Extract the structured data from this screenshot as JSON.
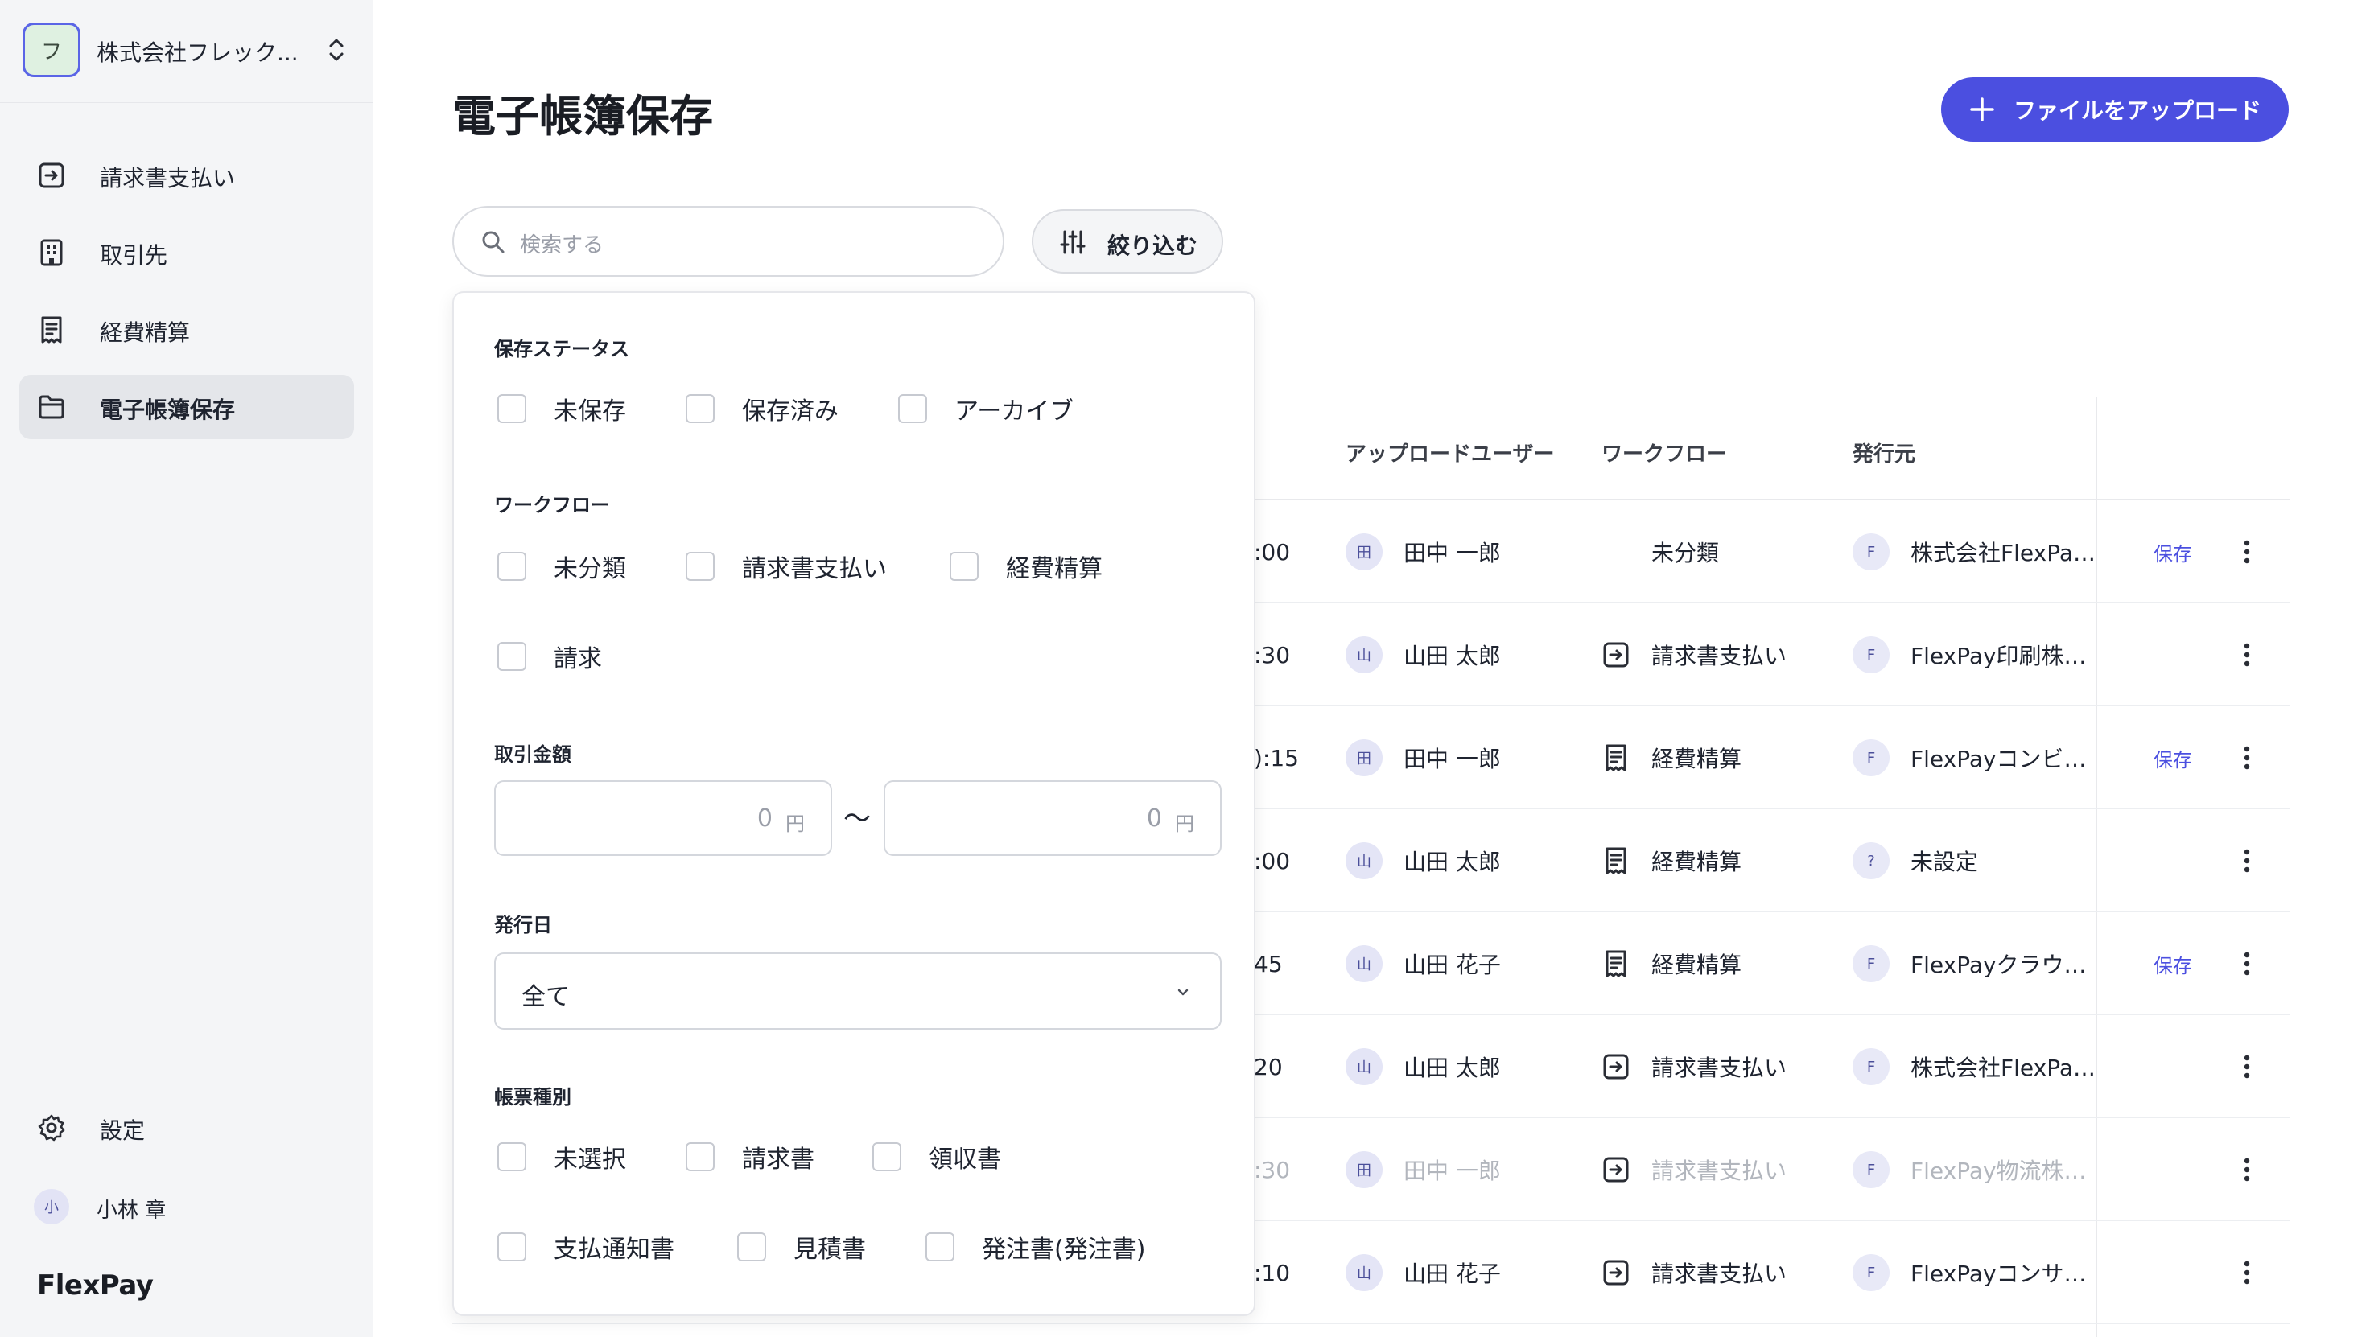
{
  "sidebar": {
    "company": {
      "initial": "フ",
      "name": "株式会社フレック..."
    },
    "nav": [
      {
        "label": "請求書支払い",
        "icon": "invoice-payment-icon"
      },
      {
        "label": "取引先",
        "icon": "building-icon"
      },
      {
        "label": "経費精算",
        "icon": "receipt-icon"
      },
      {
        "label": "電子帳簿保存",
        "icon": "folder-icon",
        "active": true
      }
    ],
    "settings": {
      "label": "設定",
      "icon": "gear-icon"
    },
    "user": {
      "initial": "小",
      "name": "小林 章"
    },
    "brand": "FlexPay"
  },
  "main": {
    "title": "電子帳簿保存",
    "upload_label": "ファイルをアップロード",
    "search_placeholder": "検索する",
    "filter_label": "絞り込む"
  },
  "table": {
    "columns": {
      "uploader": "アップロードユーザー",
      "workflow": "ワークフロー",
      "issuer": "発行元"
    },
    "rows": [
      {
        "time": ":00",
        "user_initial": "田",
        "user": "田中 一郎",
        "workflow": "未分類",
        "workflow_icon": "",
        "issuer_initial": "F",
        "issuer": "株式会社FlexPay...",
        "save": "保存",
        "dim": false
      },
      {
        "time": ":30",
        "user_initial": "山",
        "user": "山田 太郎",
        "workflow": "請求書支払い",
        "workflow_icon": "invoice-payment-icon",
        "issuer_initial": "F",
        "issuer": "FlexPay印刷株式...",
        "save": "",
        "dim": false
      },
      {
        "time": "):15",
        "user_initial": "田",
        "user": "田中 一郎",
        "workflow": "経費精算",
        "workflow_icon": "receipt-icon",
        "issuer_initial": "F",
        "issuer": "FlexPayコンビニ...",
        "save": "保存",
        "dim": false
      },
      {
        "time": ":00",
        "user_initial": "山",
        "user": "山田 太郎",
        "workflow": "経費精算",
        "workflow_icon": "receipt-icon",
        "issuer_initial": "?",
        "issuer": "未設定",
        "save": "",
        "dim": false
      },
      {
        "time": "45",
        "user_initial": "山",
        "user": "山田 花子",
        "workflow": "経費精算",
        "workflow_icon": "receipt-icon",
        "issuer_initial": "F",
        "issuer": "FlexPayクラウド...",
        "save": "保存",
        "dim": false
      },
      {
        "time": "20",
        "user_initial": "山",
        "user": "山田 太郎",
        "workflow": "請求書支払い",
        "workflow_icon": "invoice-payment-icon",
        "issuer_initial": "F",
        "issuer": "株式会社FlexPay...",
        "save": "",
        "dim": false
      },
      {
        "time": ":30",
        "user_initial": "田",
        "user": "田中 一郎",
        "workflow": "請求書支払い",
        "workflow_icon": "invoice-payment-icon",
        "issuer_initial": "F",
        "issuer": "FlexPay物流株式...",
        "save": "",
        "dim": true
      },
      {
        "time": ":10",
        "user_initial": "山",
        "user": "山田 花子",
        "workflow": "請求書支払い",
        "workflow_icon": "invoice-payment-icon",
        "issuer_initial": "F",
        "issuer": "FlexPayコンサル...",
        "save": "",
        "dim": false
      }
    ]
  },
  "filter_panel": {
    "status": {
      "title": "保存ステータス",
      "options": [
        "未保存",
        "保存済み",
        "アーカイブ"
      ]
    },
    "workflow": {
      "title": "ワークフロー",
      "options": [
        "未分類",
        "請求書支払い",
        "経費精算",
        "請求"
      ]
    },
    "amount": {
      "title": "取引金額",
      "min_value": "0",
      "max_value": "0",
      "unit": "円",
      "separator": "〜"
    },
    "issue_date": {
      "title": "発行日",
      "selected": "全て"
    },
    "doc_type": {
      "title": "帳票種別",
      "options": [
        "未選択",
        "請求書",
        "領収書",
        "支払通知書",
        "見積書",
        "発注書(発注書)"
      ]
    }
  },
  "colors": {
    "accent": "#4b4fe0",
    "sidebar_bg": "#f4f5f7",
    "active_nav_bg": "#e4e6ea"
  }
}
